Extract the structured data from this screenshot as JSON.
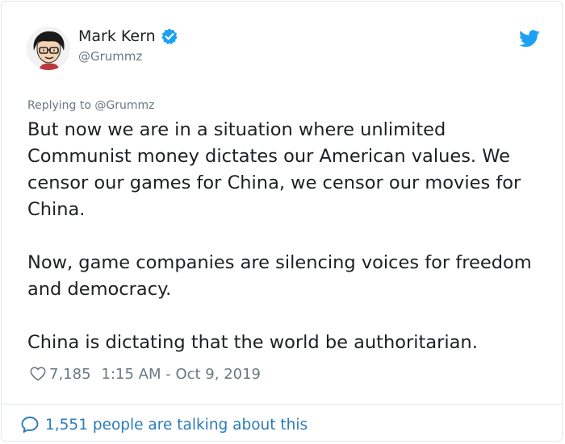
{
  "author": {
    "display_name": "Mark Kern",
    "handle": "@Grummz",
    "verified_icon": "verified-badge-icon",
    "avatar_icon": "cartoon-avatar"
  },
  "brand": {
    "icon": "twitter-bird-icon",
    "color": "#1da1f2"
  },
  "reply_context": "Replying to @Grummz",
  "tweet": {
    "paragraphs": [
      "But now we are in a situation where unlimited Communist money dictates our American values. We censor our games for China, we censor our movies for China.",
      "Now, game companies are silencing voices for freedom and democracy.",
      "China is dictating that the world be authoritarian."
    ]
  },
  "meta": {
    "like_icon": "heart-icon",
    "likes": "7,185",
    "timestamp": "1:15 AM - Oct 9, 2019"
  },
  "footer": {
    "icon": "speech-bubble-icon",
    "talking_text": "1,551 people are talking about this",
    "link_color": "#2b7bb9"
  }
}
